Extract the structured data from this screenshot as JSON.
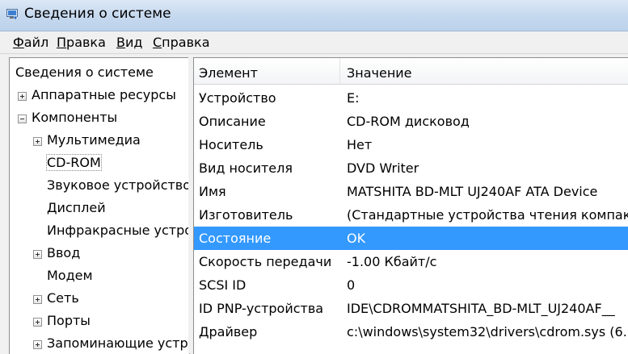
{
  "window": {
    "title": "Сведения о системе",
    "icon": "system-info-icon"
  },
  "menu": [
    {
      "text": "Файл",
      "accel": "Ф",
      "rest": "айл"
    },
    {
      "text": "Правка",
      "accel": "П",
      "rest": "равка"
    },
    {
      "text": "Вид",
      "accel": "В",
      "rest": "ид"
    },
    {
      "text": "Справка",
      "accel": "С",
      "rest": "правка"
    }
  ],
  "tree": [
    {
      "label": "Сведения о системе",
      "expander": "none"
    },
    {
      "label": "Аппаратные ресурсы",
      "expander": "plus"
    },
    {
      "label": "Компоненты",
      "expander": "minus"
    },
    {
      "label": "Мультимедиа",
      "expander": "plus"
    },
    {
      "label": "CD-ROM",
      "expander": "none",
      "selected": true
    },
    {
      "label": "Звуковое устройство",
      "expander": "none"
    },
    {
      "label": "Дисплей",
      "expander": "none"
    },
    {
      "label": "Инфракрасные устройства",
      "expander": "none"
    },
    {
      "label": "Ввод",
      "expander": "plus"
    },
    {
      "label": "Модем",
      "expander": "none"
    },
    {
      "label": "Сеть",
      "expander": "plus"
    },
    {
      "label": "Порты",
      "expander": "plus"
    },
    {
      "label": "Запоминающие устройства",
      "expander": "plus"
    }
  ],
  "columns": {
    "element": "Элемент",
    "value": "Значение"
  },
  "rows": [
    {
      "name": "Устройство",
      "value": "E:"
    },
    {
      "name": "Описание",
      "value": "CD-ROM дисковод"
    },
    {
      "name": "Носитель",
      "value": "Нет"
    },
    {
      "name": "Вид носителя",
      "value": "DVD Writer"
    },
    {
      "name": "Имя",
      "value": "MATSHITA BD-MLT UJ240AF ATA Device"
    },
    {
      "name": "Изготовитель",
      "value": "(Стандартные устройства чтения компакт-дисков)"
    },
    {
      "name": "Состояние",
      "value": "OK",
      "selected": true
    },
    {
      "name": "Скорость передачи",
      "value": "-1.00 Кбайт/с"
    },
    {
      "name": "SCSI ID",
      "value": "0"
    },
    {
      "name": "ID PNP-устройства",
      "value": "IDE\\CDROMMATSHITA_BD-MLT_UJ240AF__"
    },
    {
      "name": "Драйвер",
      "value": "c:\\windows\\system32\\drivers\\cdrom.sys (6.1"
    }
  ],
  "colors": {
    "selection": "#3399ff",
    "titlebar": "#c5d8ee"
  }
}
